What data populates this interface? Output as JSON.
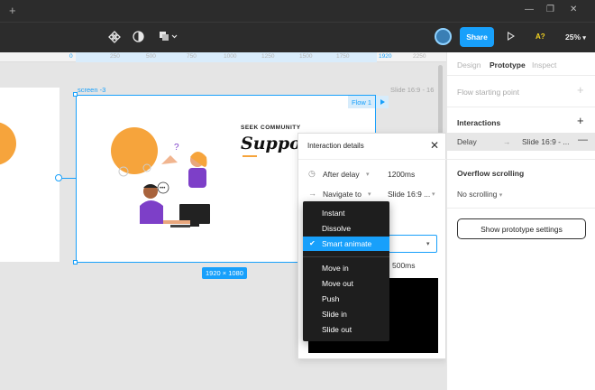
{
  "toolbar": {
    "share_label": "Share",
    "ab_label": "A?",
    "zoom": "25%"
  },
  "ruler": {
    "ticks": [
      "0",
      "250",
      "500",
      "750",
      "1000",
      "1250",
      "1500",
      "1750",
      "1920",
      "2250"
    ],
    "highlight": [
      "0",
      "1920"
    ]
  },
  "canvas": {
    "frame_name": "screen -3",
    "right_frame_name": "Slide 16:9 - 16",
    "flow_label": "Flow 1",
    "frame_size": "1920 × 1080",
    "frame_content": {
      "eyebrow": "SEEK COMMUNITY",
      "headline": "Suppor"
    }
  },
  "details": {
    "title": "Interaction details",
    "trigger": "After delay",
    "delay": "1200ms",
    "action": "Navigate to",
    "destination": "Slide 16:9 ...",
    "duration": "500ms",
    "animation_options": [
      {
        "label": "Instant",
        "selected": false
      },
      {
        "label": "Dissolve",
        "selected": false
      },
      {
        "label": "Smart animate",
        "selected": true
      },
      {
        "label": "Move in",
        "selected": false
      },
      {
        "label": "Move out",
        "selected": false
      },
      {
        "label": "Push",
        "selected": false
      },
      {
        "label": "Slide in",
        "selected": false
      },
      {
        "label": "Slide out",
        "selected": false
      }
    ]
  },
  "panel": {
    "tabs": [
      "Design",
      "Prototype",
      "Inspect"
    ],
    "active_tab": "Prototype",
    "flow_starting_point": "Flow starting point",
    "interactions_title": "Interactions",
    "interaction": {
      "trigger": "Delay",
      "target": "Slide 16:9 - ..."
    },
    "overflow_title": "Overflow scrolling",
    "overflow_value": "No scrolling",
    "settings_button": "Show prototype settings"
  },
  "colors": {
    "accent": "#18a0fb",
    "toolbar_bg": "#2c2c2c",
    "menu_bg": "#1e1e1e",
    "illustration_orange": "#f6a43c",
    "illustration_purple": "#7d3fc8"
  }
}
